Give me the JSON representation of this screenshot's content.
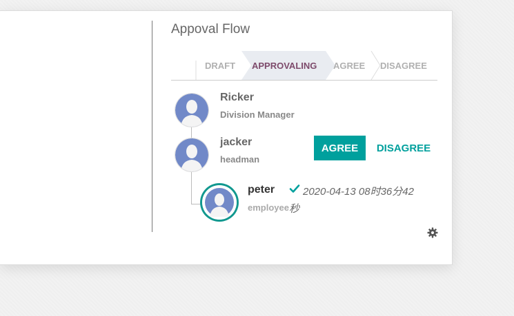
{
  "panel": {
    "title": "Appoval Flow"
  },
  "statusbar": {
    "stages": [
      {
        "label": "DRAFT",
        "active": false
      },
      {
        "label": "APPROVALING",
        "active": true
      },
      {
        "label": "AGREE",
        "active": false
      },
      {
        "label": "DISAGREE",
        "active": false
      }
    ]
  },
  "approvers": [
    {
      "name": "Ricker",
      "role": "Division Manager"
    },
    {
      "name": "jacker",
      "role": "headman"
    },
    {
      "name": "peter",
      "role": "employee",
      "timestamp": "2020-04-13 08时36分42",
      "timestamp_tail": "秒"
    }
  ],
  "actions": {
    "agree_label": "AGREE",
    "disagree_label": "DISAGREE"
  },
  "colors": {
    "accent": "#00a09d",
    "active_stage": "#7d4a6b",
    "avatar": "#7189c8"
  },
  "icons": {
    "approved": "check-icon",
    "settings": "gear-icon",
    "avatar": "person-placeholder-icon"
  }
}
